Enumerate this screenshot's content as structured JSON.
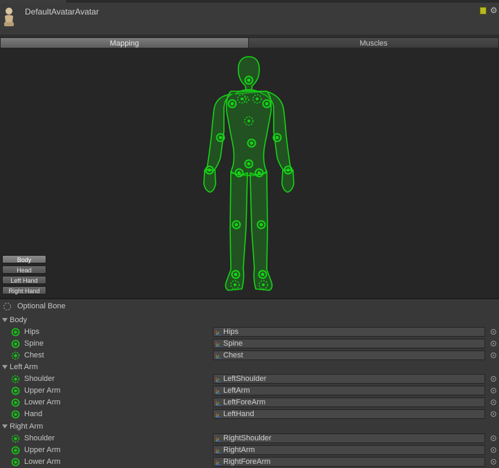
{
  "header": {
    "title": "DefaultAvatarAvatar"
  },
  "tabs": [
    "Mapping",
    "Muscles"
  ],
  "body_parts": [
    "Body",
    "Head",
    "Left Hand",
    "Right Hand"
  ],
  "legend": {
    "optional_label": "Optional Bone"
  },
  "groups": [
    {
      "label": "Body",
      "bones": [
        {
          "label": "Hips",
          "value": "Hips",
          "optional": false
        },
        {
          "label": "Spine",
          "value": "Spine",
          "optional": false
        },
        {
          "label": "Chest",
          "value": "Chest",
          "optional": true
        }
      ]
    },
    {
      "label": "Left Arm",
      "bones": [
        {
          "label": "Shoulder",
          "value": "LeftShoulder",
          "optional": true
        },
        {
          "label": "Upper Arm",
          "value": "LeftArm",
          "optional": false
        },
        {
          "label": "Lower Arm",
          "value": "LeftForeArm",
          "optional": false
        },
        {
          "label": "Hand",
          "value": "LeftHand",
          "optional": false
        }
      ]
    },
    {
      "label": "Right Arm",
      "bones": [
        {
          "label": "Shoulder",
          "value": "RightShoulder",
          "optional": true
        },
        {
          "label": "Upper Arm",
          "value": "RightArm",
          "optional": false
        },
        {
          "label": "Lower Arm",
          "value": "RightForeArm",
          "optional": false
        }
      ]
    }
  ],
  "colors": {
    "bone_green": "#16c216",
    "canvas": "#262626",
    "panel": "#383838"
  }
}
